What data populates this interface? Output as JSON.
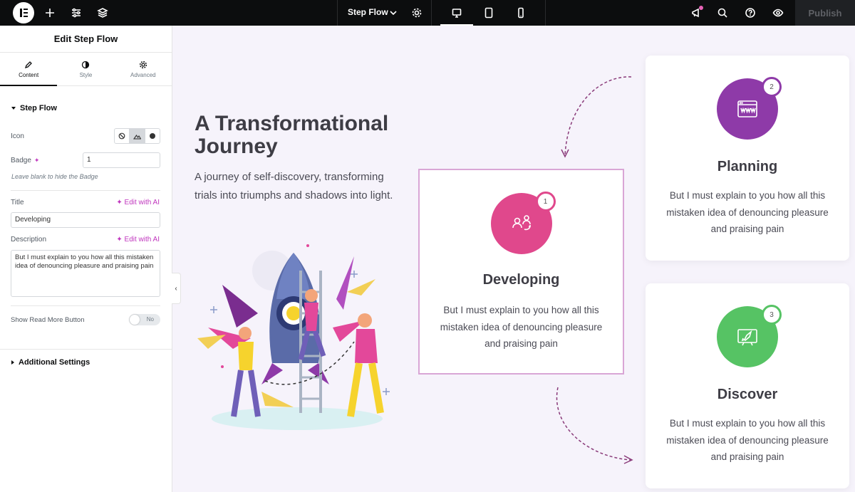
{
  "toolbar": {
    "document_title": "Step Flow",
    "publish_label": "Publish"
  },
  "panel": {
    "title": "Edit Step Flow",
    "tabs": [
      {
        "label": "Content",
        "icon": "pencil-icon",
        "active": true
      },
      {
        "label": "Style",
        "icon": "contrast-icon",
        "active": false
      },
      {
        "label": "Advanced",
        "icon": "gear-icon",
        "active": false
      }
    ],
    "section_step_flow": "Step Flow",
    "icon_label": "Icon",
    "badge_label": "Badge",
    "badge_value": "1",
    "badge_hint": "Leave blank to hide the Badge",
    "title_label": "Title",
    "title_value": "Developing",
    "edit_with_ai": "Edit with AI",
    "description_label": "Description",
    "description_value": "But I must explain to you how all this mistaken idea of denouncing pleasure and praising pain",
    "read_more_label": "Show Read More Button",
    "read_more_state": "No",
    "section_additional": "Additional Settings"
  },
  "hero": {
    "title": "A Transformational Journey",
    "subtitle": "A journey of self-discovery, transforming trials into triumphs and shadows into light."
  },
  "steps": [
    {
      "badge": "1",
      "title": "Developing",
      "description": "But I must explain to you how all this mistaken idea of denouncing pleasure and praising pain",
      "color": "#e0488c",
      "icon": "team-exchange-icon"
    },
    {
      "badge": "2",
      "title": "Planning",
      "description": "But I must explain to you how all this mistaken idea of denouncing pleasure and praising pain",
      "color": "#8e3aa8",
      "icon": "web-browser-icon"
    },
    {
      "badge": "3",
      "title": "Discover",
      "description": "But I must explain to you how all this mistaken idea of denouncing pleasure and praising pain",
      "color": "#56c364",
      "icon": "rocket-launch-icon"
    }
  ],
  "colors": {
    "topbar": "#0c0d0e",
    "accent_ai": "#c036be",
    "canvas_bg": "#f6f3fb",
    "arrow": "#8a3b7a"
  }
}
